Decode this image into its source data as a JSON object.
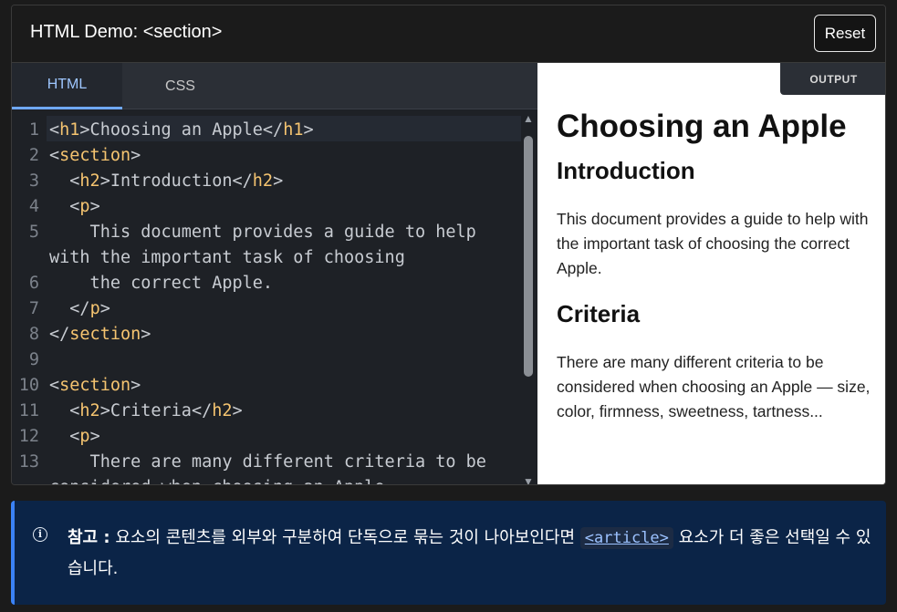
{
  "header": {
    "title": "HTML Demo: <section>",
    "reset_label": "Reset"
  },
  "editor": {
    "tabs": [
      {
        "label": "HTML",
        "active": true
      },
      {
        "label": "CSS",
        "active": false
      }
    ],
    "lines": [
      {
        "n": "1",
        "text": "<h1>Choosing an Apple</h1>"
      },
      {
        "n": "2",
        "text": "<section>"
      },
      {
        "n": "3",
        "text": "  <h2>Introduction</h2>"
      },
      {
        "n": "4",
        "text": "  <p>"
      },
      {
        "n": "5",
        "text": "    This document provides a guide to help"
      },
      {
        "n": "",
        "text": "with the important task of choosing"
      },
      {
        "n": "6",
        "text": "    the correct Apple."
      },
      {
        "n": "7",
        "text": "  </p>"
      },
      {
        "n": "8",
        "text": "</section>"
      },
      {
        "n": "9",
        "text": ""
      },
      {
        "n": "10",
        "text": "<section>"
      },
      {
        "n": "11",
        "text": "  <h2>Criteria</h2>"
      },
      {
        "n": "12",
        "text": "  <p>"
      },
      {
        "n": "13",
        "text": "    There are many different criteria to be"
      },
      {
        "n": "",
        "text": "considered when choosing an Apple —"
      }
    ]
  },
  "output": {
    "tab_label": "OUTPUT",
    "h1": "Choosing an Apple",
    "h2_intro": "Introduction",
    "p_intro": "This document provides a guide to help with the important task of choosing the correct Apple.",
    "h2_criteria": "Criteria",
    "p_criteria": "There are many different criteria to be considered when choosing an Apple — size, color, firmness, sweetness, tartness..."
  },
  "note": {
    "icon": "info-icon",
    "label": "참고 :",
    "text_before": " 요소의 콘텐츠를 외부와 구분하여 단독으로 묶는 것이 나아보인다면 ",
    "code_link": "<article>",
    "text_after": " 요소가 더 좋은 선택일 수 있습니다."
  },
  "colors": {
    "tag": "#f5c470",
    "active_tab": "#9ec6ff",
    "note_bg": "#0b2447"
  }
}
